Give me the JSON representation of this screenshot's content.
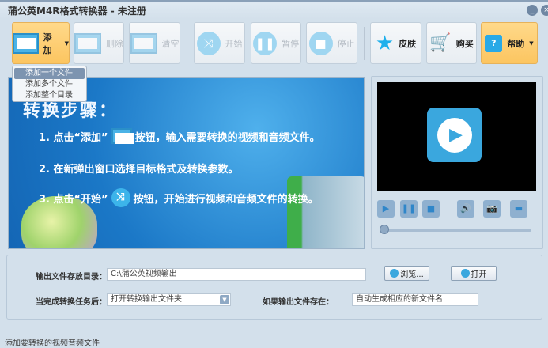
{
  "window": {
    "title": "蒲公英M4R格式转换器 - 未注册",
    "minimize": "_",
    "close": "×"
  },
  "toolbar": {
    "add": "添加",
    "delete": "删除",
    "clear": "清空",
    "start": "开始",
    "pause": "暂停",
    "stop": "停止",
    "skin": "皮肤",
    "buy": "购买",
    "help": "帮助"
  },
  "add_menu": [
    "添加一个文件",
    "添加多个文件",
    "添加整个目录"
  ],
  "banner": {
    "heading": "转换步骤：",
    "step1_a": "1. 点击“添加”",
    "step1_b": "按钮，输入需要转换的视频和音频文件。",
    "step2": "2. 在新弹出窗口选择目标格式及转换参数。",
    "step3_a": "3. 点击“开始”",
    "step3_b": "按钮，开始进行视频和音频文件的转换。"
  },
  "player": {
    "progress": 0
  },
  "options": {
    "output_dir_label": "输出文件存放目录：",
    "output_dir_value": "C:\\蒲公英视频输出",
    "browse": "浏览...",
    "open": "打开",
    "after_label": "当完成转换任务后：",
    "after_value": "打开转换输出文件夹",
    "exists_label": "如果输出文件存在：",
    "exists_value": "自动生成相应的新文件名"
  },
  "status": "添加要转换的视频音频文件"
}
